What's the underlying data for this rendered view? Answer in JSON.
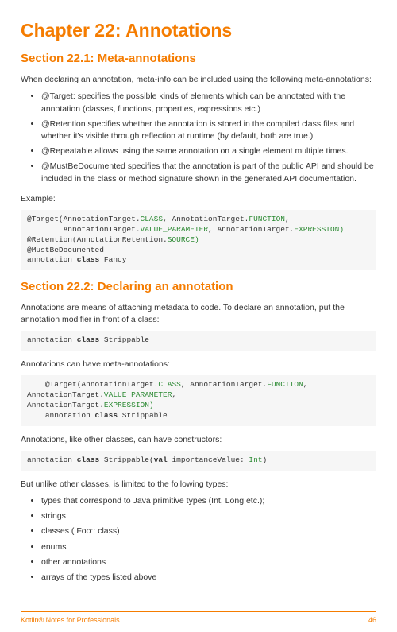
{
  "h1": "Chapter 22: Annotations",
  "s1": {
    "title": "Section 22.1: Meta-annotations",
    "intro": "When declaring an annotation, meta-info can be included using the following meta-annotations:",
    "items": [
      "@Target: specifies the possible kinds of elements which can be annotated with the annotation (classes, functions, properties, expressions etc.)",
      "@Retention specifies whether the annotation is stored in the compiled class files and whether it's visible through reflection at runtime (by default, both are true.)",
      "@Repeatable allows using the same annotation on a single element multiple times.",
      "@MustBeDocumented specifies that the annotation is part of the public API and should be included in the class or method signature shown in the generated API documentation."
    ],
    "example_label": "Example:",
    "code": {
      "l1a": "@Target(AnnotationTarget.",
      "l1b": "CLASS",
      "l1c": ", AnnotationTarget.",
      "l1d": "FUNCTION",
      "l1e": ",",
      "l2a": "        AnnotationTarget.",
      "l2b": "VALUE_PARAMETER",
      "l2c": ", AnnotationTarget.",
      "l2d": "EXPRESSION)",
      "l3a": "@Retention(AnnotationRetention.",
      "l3b": "SOURCE)",
      "l4": "@MustBeDocumented",
      "l5a": "annotation ",
      "l5b": "class",
      "l5c": " Fancy"
    }
  },
  "s2": {
    "title": "Section 22.2: Declaring an annotation",
    "p1": "Annotations are means of attaching metadata to code. To declare an annotation, put the annotation modifier in front of a class:",
    "code1": {
      "a": "annotation ",
      "b": "class",
      "c": " Strippable"
    },
    "p2": "Annotations can have meta-annotations:",
    "code2": {
      "a": "    @Target(AnnotationTarget.",
      "b": "CLASS",
      "c": ", AnnotationTarget.",
      "d": "FUNCTION",
      "e": ", AnnotationTarget.",
      "f": "VALUE_PARAMETER",
      "g": ",\nAnnotationTarget.",
      "h": "EXPRESSION)",
      "i": "\n    annotation ",
      "j": "class",
      "k": " Strippable"
    },
    "p3": "Annotations, like other classes, can have constructors:",
    "code3": {
      "a": "annotation ",
      "b": "class",
      "c": " Strippable(",
      "d": "val",
      "e": " importanceValue: ",
      "f": "Int",
      "g": ")"
    },
    "p4": "But unlike other classes, is limited to the following types:",
    "items": [
      "types that correspond to Java primitive types (Int, Long etc.);",
      "strings",
      "classes ( Foo:: class)",
      "enums",
      "other annotations",
      "arrays of the types listed above"
    ]
  },
  "footer": {
    "left": "Kotlin® Notes for Professionals",
    "right": "46"
  }
}
